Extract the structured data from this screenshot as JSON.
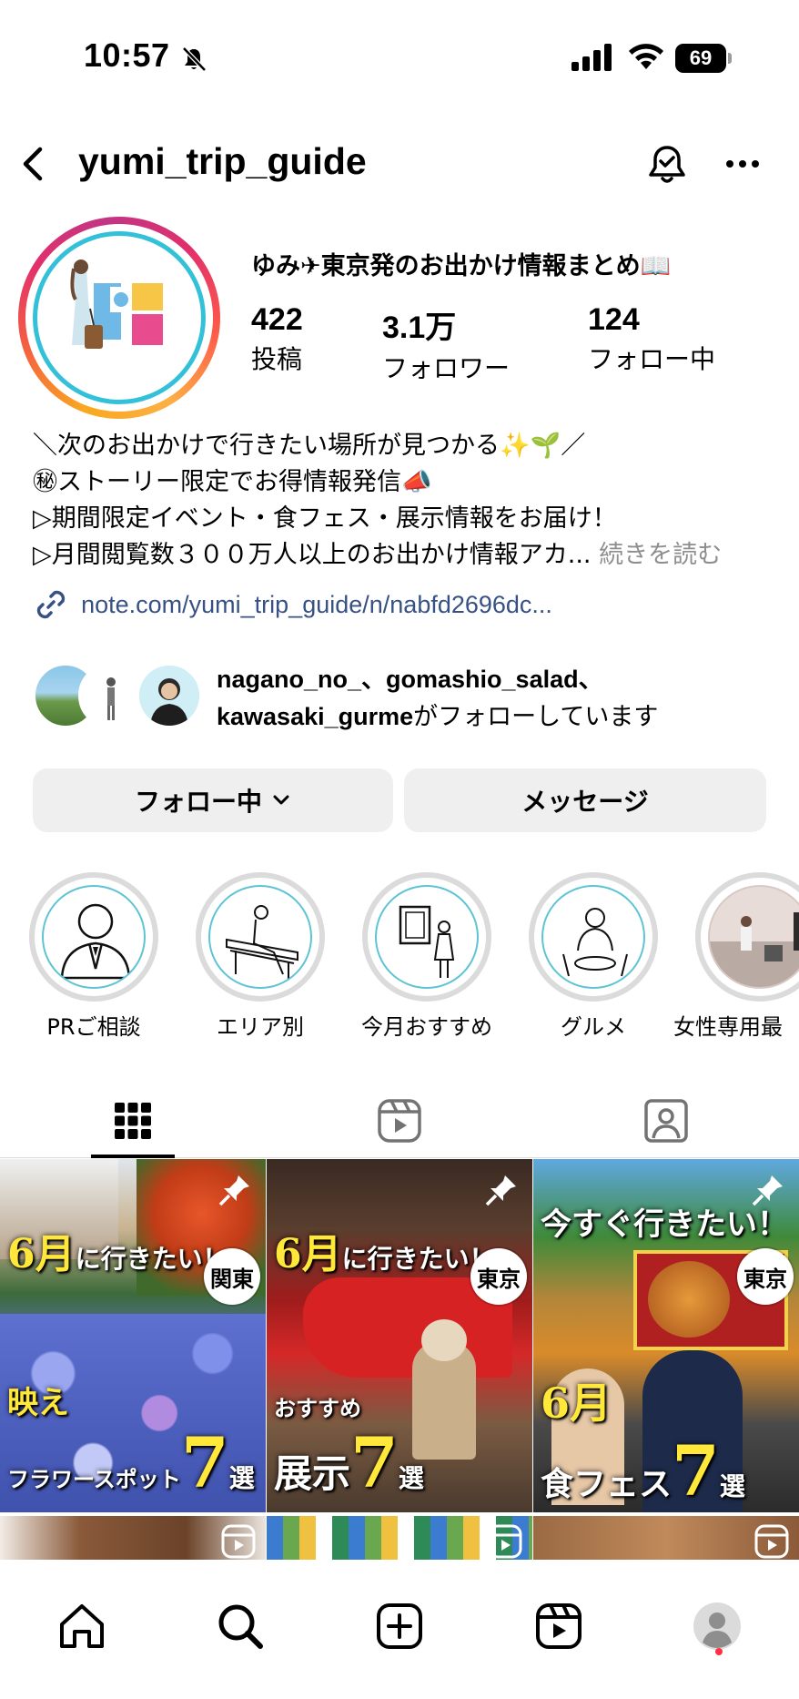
{
  "status_bar": {
    "time": "10:57",
    "battery": "69"
  },
  "header": {
    "username": "yumi_trip_guide"
  },
  "profile": {
    "display_name": "ゆみ✈東京発のお出かけ情報まとめ📖",
    "stats": [
      {
        "value": "422",
        "label": "投稿"
      },
      {
        "value": "3.1万",
        "label": "フォロワー"
      },
      {
        "value": "124",
        "label": "フォロー中"
      }
    ],
    "bio_lines": [
      "＼次のお出かけで行きたい場所が見つかる✨🌱／",
      "㊙ストーリー限定でお得情報発信📣",
      "▷期間限定イベント・食フェス・展示情報をお届け！",
      "▷月間閲覧数３００万人以上のお出かけ情報アカ..."
    ],
    "bio_more": "続きを読む",
    "link": "note.com/yumi_trip_guide/n/nabfd2696dc..."
  },
  "followed_by": {
    "names": "nagano_no_、gomashio_salad、",
    "name_last": "kawasaki_gurme",
    "suffix": "がフォローしています"
  },
  "actions": {
    "following_label": "フォロー中",
    "message_label": "メッセージ"
  },
  "highlights": [
    {
      "label": "PRご相談",
      "icon": "businessman-icon"
    },
    {
      "label": "エリア別",
      "icon": "bench-person-icon"
    },
    {
      "label": "今月おすすめ",
      "icon": "art-gallery-icon"
    },
    {
      "label": "グルメ",
      "icon": "dining-woman-icon"
    },
    {
      "label": "女性専用最",
      "icon": "photo"
    }
  ],
  "tabs": [
    {
      "name": "grid-icon",
      "active": true
    },
    {
      "name": "reels-icon",
      "active": false
    },
    {
      "name": "tagged-icon",
      "active": false
    }
  ],
  "posts": [
    {
      "head_yellow": "6月",
      "head_white": "に行きたい！",
      "region": "関東",
      "sub_yellow": "映え",
      "sub_white": "フラワースポット",
      "number": "7",
      "unit": "選"
    },
    {
      "head_yellow": "6月",
      "head_white": "に行きたい！",
      "region": "東京",
      "sub_white_small": "おすすめ",
      "sub_white": "展示",
      "number": "7",
      "unit": "選"
    },
    {
      "head_white_only": "今すぐ行きたい！",
      "region": "東京",
      "sub_yellow": "6月",
      "sub_white": "食フェス",
      "number": "7",
      "unit": "選"
    }
  ],
  "bottom_nav": [
    "home-icon",
    "search-icon",
    "create-icon",
    "reels-icon",
    "profile-icon"
  ]
}
